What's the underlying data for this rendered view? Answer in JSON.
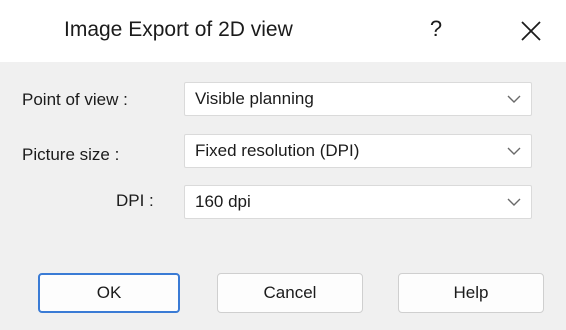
{
  "window": {
    "title": "Image Export of 2D view",
    "help_glyph": "?",
    "close_icon": "close-icon"
  },
  "form": {
    "point_of_view": {
      "label": "Point of view :",
      "value": "Visible planning"
    },
    "picture_size": {
      "label": "Picture size :",
      "value": "Fixed resolution (DPI)"
    },
    "dpi": {
      "label": "DPI :",
      "value": "160 dpi"
    }
  },
  "buttons": {
    "ok": "OK",
    "cancel": "Cancel",
    "help": "Help"
  },
  "colors": {
    "primary_border": "#3a7bd5",
    "background": "#f0f0f0",
    "titlebar": "#ffffff"
  }
}
